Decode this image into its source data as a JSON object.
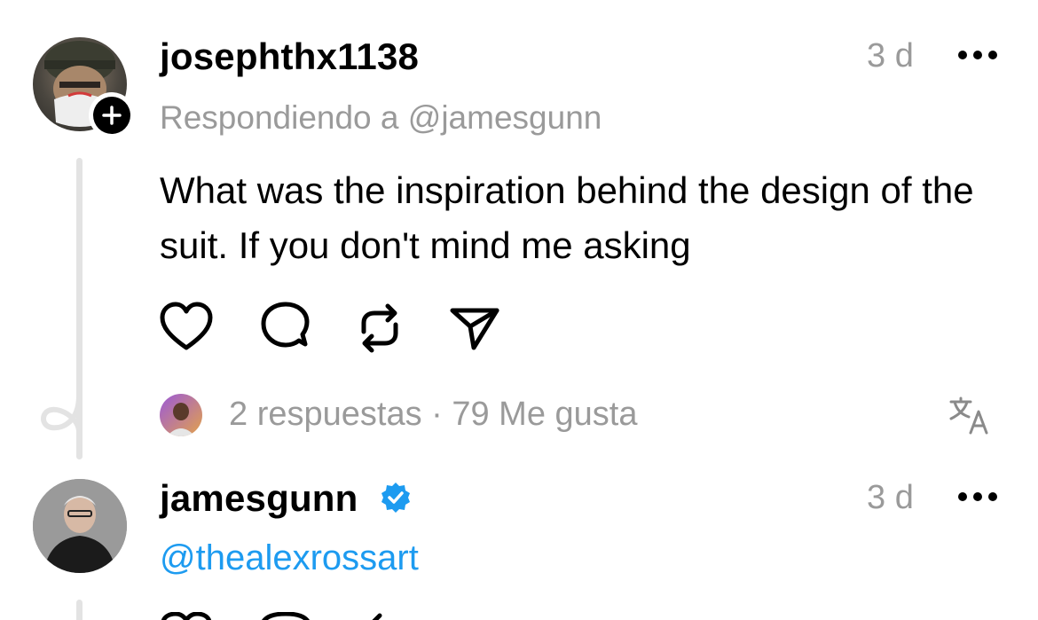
{
  "posts": [
    {
      "username": "josephthx1138",
      "time": "3 d",
      "reply_to": "Respondiendo a @jamesgunn",
      "text": "What was the inspiration behind the design of the suit. If you don't mind me asking",
      "stats": "2 respuestas · 79 Me gusta",
      "icons": {
        "like": "heart-icon",
        "comment": "comment-icon",
        "repost": "repost-icon",
        "share": "send-icon",
        "translate": "translate-icon",
        "more": "more-icon"
      }
    },
    {
      "username": "jamesgunn",
      "time": "3 d",
      "mention": "@thealexrossart",
      "verified": true
    }
  ],
  "colors": {
    "muted": "#9a9a9a",
    "link": "#1d9bf0",
    "verified": "#1d9bf0",
    "thread_line": "#e3e3e3"
  }
}
